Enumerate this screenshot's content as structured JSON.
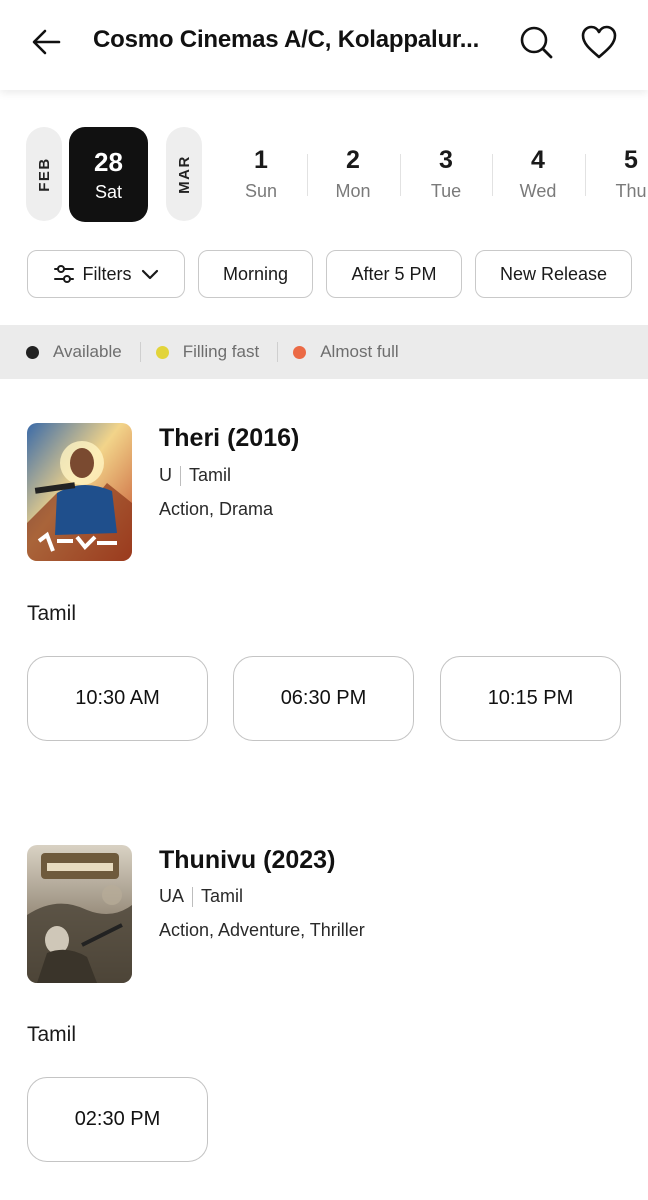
{
  "header": {
    "title": "Cosmo Cinemas A/C, Kolappalur...",
    "icons": {
      "back": "arrow-left-icon",
      "search": "search-icon",
      "favorite": "heart-icon"
    }
  },
  "dates": {
    "month_prev": "FEB",
    "month_next": "MAR",
    "selected": {
      "num": "28",
      "day": "Sat"
    },
    "items": [
      {
        "num": "1",
        "day": "Sun"
      },
      {
        "num": "2",
        "day": "Mon"
      },
      {
        "num": "3",
        "day": "Tue"
      },
      {
        "num": "4",
        "day": "Wed"
      },
      {
        "num": "5",
        "day": "Thu"
      }
    ]
  },
  "filters": {
    "filters_label": "Filters",
    "chips": [
      "Morning",
      "After 5 PM",
      "New Release"
    ]
  },
  "legend": [
    {
      "label": "Available",
      "color": "#222222"
    },
    {
      "label": "Filling fast",
      "color": "#e2d43a"
    },
    {
      "label": "Almost full",
      "color": "#eb6a45"
    }
  ],
  "movies": [
    {
      "title": "Theri (2016)",
      "rating": "U",
      "language": "Tamil",
      "genres": "Action, Drama",
      "show_language": "Tamil",
      "showtimes": [
        "10:30 AM",
        "06:30 PM",
        "10:15 PM"
      ]
    },
    {
      "title": "Thunivu (2023)",
      "rating": "UA",
      "language": "Tamil",
      "genres": "Action, Adventure, Thriller",
      "show_language": "Tamil",
      "showtimes": [
        "02:30 PM"
      ]
    }
  ]
}
